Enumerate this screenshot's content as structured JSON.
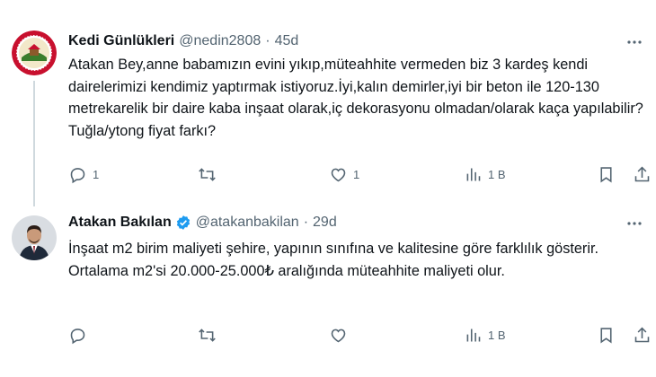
{
  "tweets": [
    {
      "name": "Kedi Günlükleri",
      "handle": "@nedin2808",
      "dot": "·",
      "time": "45d",
      "text": "Atakan Bey,anne babamızın evini yıkıp,müteahhite vermeden biz 3 kardeş kendi dairelerimizi kendimiz yaptırmak istiyoruz.İyi,kalın demirler,iyi bir beton ile 120-130 metrekarelik bir daire kaba inşaat olarak,iç dekorasyonu olmadan/olarak kaça yapılabilir?Tuğla/ytong fiyat farkı?",
      "replies": "1",
      "retweets": "",
      "likes": "1",
      "views": "1 B"
    },
    {
      "name": "Atakan Bakılan",
      "handle": "@atakanbakilan",
      "dot": "·",
      "time": "29d",
      "text": "İnşaat m2 birim maliyeti şehire, yapının sınıfına ve kalitesine göre farklılık gösterir. Ortalama m2'si 20.000-25.000₺ aralığında müteahhite maliyeti olur.",
      "replies": "",
      "retweets": "",
      "likes": "",
      "views": "1 B"
    }
  ],
  "icons": {
    "reply": "reply-icon",
    "retweet": "retweet-icon",
    "like": "like-icon",
    "views": "views-icon",
    "bookmark": "bookmark-icon",
    "share": "share-icon",
    "more": "more-icon",
    "verified": "verified-badge-icon"
  },
  "colors": {
    "text": "#0f1419",
    "secondary": "#536471",
    "verified": "#1d9bf0",
    "thread_line": "#cfd9de"
  }
}
